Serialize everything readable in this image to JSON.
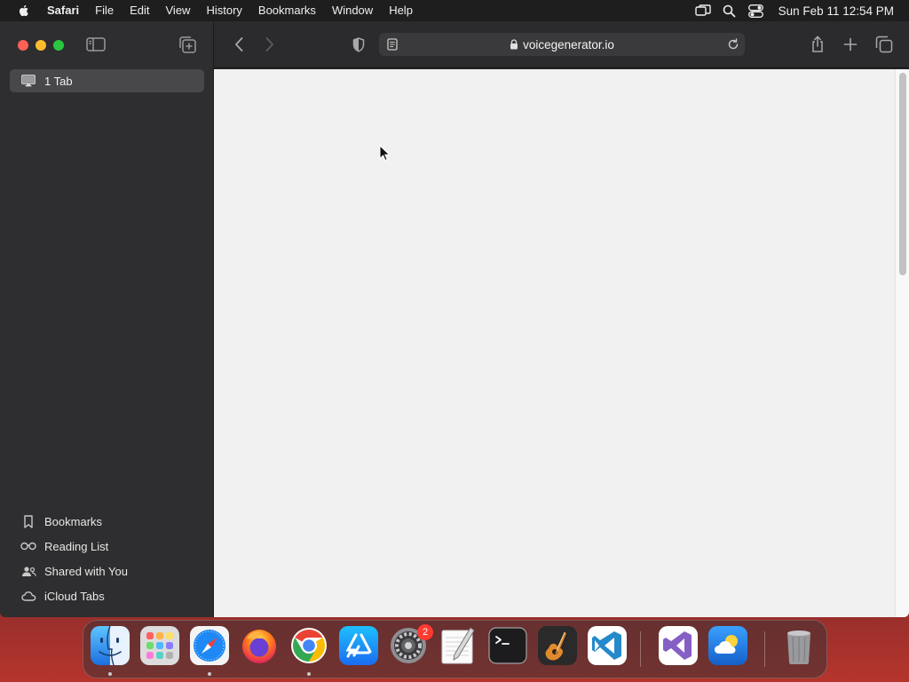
{
  "menubar": {
    "app_name": "Safari",
    "items": [
      "File",
      "Edit",
      "View",
      "History",
      "Bookmarks",
      "Window",
      "Help"
    ],
    "clock": "Sun Feb 11  12:54 PM"
  },
  "sidebar": {
    "tab_group_label": "1 Tab",
    "links": [
      {
        "label": "Bookmarks",
        "icon": "bookmark-icon"
      },
      {
        "label": "Reading List",
        "icon": "glasses-icon"
      },
      {
        "label": "Shared with You",
        "icon": "shared-with-you-icon"
      },
      {
        "label": "iCloud Tabs",
        "icon": "cloud-icon"
      }
    ]
  },
  "toolbar": {
    "url": "voicegenerator.io"
  },
  "dock": {
    "apps": [
      "Finder",
      "Launchpad",
      "Safari",
      "Firefox",
      "Chrome",
      "App Store",
      "System Settings",
      "TextEdit",
      "Terminal",
      "GarageBand",
      "Visual Studio Code",
      "Visual Studio",
      "Weather",
      "Trash"
    ],
    "settings_badge": "2"
  },
  "colors": {
    "traffic_red": "#fe5f57",
    "traffic_yellow": "#febc2e",
    "traffic_green": "#28c840",
    "content_bg": "#f1f1f1"
  }
}
